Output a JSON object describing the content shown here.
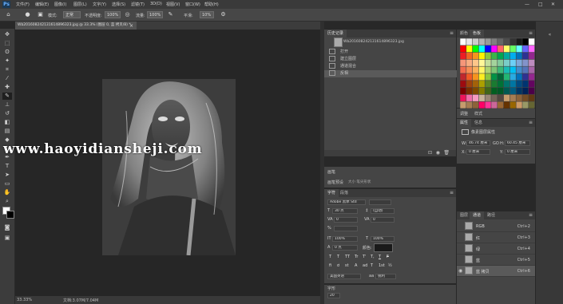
{
  "app": {
    "logo": "Ps",
    "window_controls": [
      "—",
      "□",
      "✕"
    ]
  },
  "menu": [
    "文件(F)",
    "编辑(E)",
    "图像(I)",
    "图层(L)",
    "文字(Y)",
    "选择(S)",
    "滤镜(T)",
    "3D(D)",
    "视图(V)",
    "窗口(W)",
    "帮助(H)"
  ],
  "options": {
    "mode_label": "模式:",
    "mode_value": "正常",
    "opacity_label": "不透明度:",
    "opacity_value": "100%",
    "flow_label": "流量:",
    "flow_value": "100%",
    "smooth_label": "平滑:",
    "smooth_value": "10%"
  },
  "document": {
    "tab_label": "Wb201608242131614896323.jpg @ 33.3% (图层 0, 蓝 拷贝/8) *",
    "close": "×"
  },
  "status": {
    "zoom": "33.33%",
    "doc": "文档:3.07M/7.04M"
  },
  "watermark": "www.haoyidiansheji.com",
  "history": {
    "title": "历史记录",
    "snapshot": "Wb201608242131614896323.jpg",
    "items": [
      "打开",
      "建立图层",
      "通道混合",
      "反相"
    ]
  },
  "swatches_panel": {
    "tabs": [
      "颜色",
      "色板"
    ],
    "colors": [
      [
        "#ffffff",
        "#e6e6e6",
        "#cccccc",
        "#b3b3b3",
        "#999999",
        "#808080",
        "#666666",
        "#4d4d4d",
        "#333333",
        "#1a1a1a",
        "#000000",
        "#ffffff"
      ],
      [
        "#ff0000",
        "#ffff00",
        "#00ff00",
        "#00ffff",
        "#0000ff",
        "#ff00ff",
        "#ff6666",
        "#ffff66",
        "#66ff66",
        "#66ffff",
        "#6666ff",
        "#ff66ff"
      ],
      [
        "#ee1d24",
        "#f26522",
        "#f7941d",
        "#fff200",
        "#8dc63f",
        "#39b54a",
        "#00a651",
        "#00a99d",
        "#00aeef",
        "#0072bc",
        "#2e3192",
        "#92278f"
      ],
      [
        "#f69679",
        "#f9ad81",
        "#fdc68a",
        "#fff799",
        "#c4df9b",
        "#a3d39c",
        "#82ca9c",
        "#7accc8",
        "#6dcff6",
        "#7da7d9",
        "#8393ca",
        "#bd8cbf"
      ],
      [
        "#f26c4f",
        "#f68e55",
        "#fbaf5c",
        "#fff467",
        "#acd372",
        "#7cc576",
        "#3bb878",
        "#1abbb4",
        "#00bff3",
        "#438ccb",
        "#5574b9",
        "#a864a8"
      ],
      [
        "#c1272d",
        "#f15a24",
        "#f7931e",
        "#fcee21",
        "#8cc63f",
        "#009245",
        "#006837",
        "#22b573",
        "#29abe2",
        "#0071bc",
        "#2e3192",
        "#93278f"
      ],
      [
        "#9e0b0f",
        "#a0410d",
        "#a36209",
        "#aba000",
        "#598527",
        "#197b30",
        "#007236",
        "#00746b",
        "#0076a3",
        "#004a80",
        "#003471",
        "#630460"
      ],
      [
        "#790000",
        "#7b2e00",
        "#7d4900",
        "#827b00",
        "#406618",
        "#005e20",
        "#005826",
        "#005952",
        "#005b7f",
        "#003663",
        "#002157",
        "#4b0049"
      ],
      [
        "#ed145b",
        "#f06eaa",
        "#f49ac1",
        "#c7b299",
        "#998675",
        "#736357",
        "#534741",
        "#c69c6d",
        "#a67c52",
        "#8c6239",
        "#754c24",
        "#603913"
      ],
      [
        "#c69c6d",
        "#a67c52",
        "#8c6239",
        "#ff0066",
        "#ff3399",
        "#cc6699",
        "#996633",
        "#663300",
        "#996600",
        "#cc9966",
        "#999966",
        "#666633"
      ]
    ]
  },
  "adjust_panel": {
    "tabs": [
      "调整",
      "样式"
    ],
    "label": "属性"
  },
  "properties": {
    "tabs": [
      "属性",
      "信息"
    ],
    "title": "像素图层属性",
    "w_label": "W:",
    "w_value": "46.74 厘米",
    "link": "GO",
    "h_label": "H:",
    "h_value": "60.45 厘米",
    "x_label": "X:",
    "x_value": "0 厘米",
    "y_label": "Y:",
    "y_value": "0 厘米"
  },
  "mini_panels": {
    "brush": "画笔",
    "brush_preset": "画笔预设",
    "brush_sub": "大小 笔尖形状"
  },
  "character": {
    "tabs": [
      "字符",
      "段落"
    ],
    "font": "Adobe 黑体 Std",
    "style": "",
    "size": "30 点",
    "leading": "(自动)",
    "kerning": "0",
    "tracking": "0",
    "vscale": "100%",
    "hscale": "100%",
    "baseline": "0 点",
    "color_label": "颜色:",
    "styles": [
      "T",
      "T",
      "TT",
      "Tr",
      "T'",
      "T,",
      "T",
      "F"
    ],
    "ot": [
      "fi",
      "ơ",
      "st",
      "A",
      "ad",
      "T",
      "1st",
      "½"
    ],
    "lang": "美国英语",
    "aa": "aa",
    "aa_value": "锐利"
  },
  "bottom_panel": {
    "label": "字形",
    "value": "20"
  },
  "channels": {
    "tabs": [
      "图层",
      "通道",
      "路径"
    ],
    "rows": [
      {
        "name": "RGB",
        "shortcut": "Ctrl+2"
      },
      {
        "name": "红",
        "shortcut": "Ctrl+3"
      },
      {
        "name": "绿",
        "shortcut": "Ctrl+4"
      },
      {
        "name": "蓝",
        "shortcut": "Ctrl+5"
      },
      {
        "name": "蓝 拷贝",
        "shortcut": "Ctrl+6"
      }
    ]
  }
}
